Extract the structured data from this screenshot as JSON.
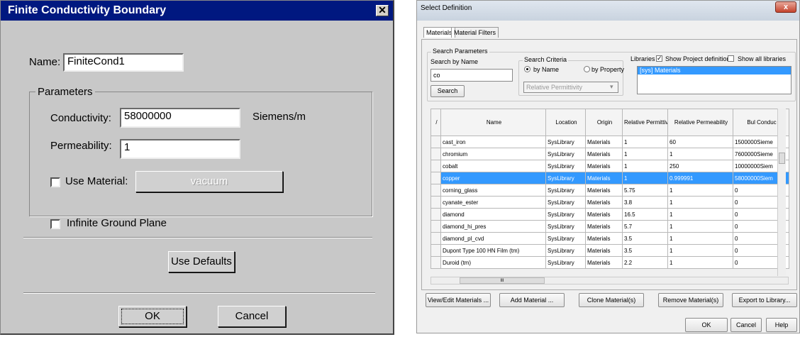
{
  "fcb": {
    "title": "Finite Conductivity Boundary",
    "close_glyph": "✕",
    "name_label": "Name:",
    "name_value": "FiniteCond1",
    "parameters_label": "Parameters",
    "conductivity_label": "Conductivity:",
    "conductivity_value": "58000000",
    "conductivity_unit": "Siemens/m",
    "permeability_label": "Permeability:",
    "permeability_value": "1",
    "use_material_label": "Use Material:",
    "use_material_checked": false,
    "material_button": "vacuum",
    "infinite_ground_label": "Infinite Ground Plane",
    "infinite_ground_checked": false,
    "use_defaults": "Use Defaults",
    "ok": "OK",
    "cancel": "Cancel"
  },
  "sd": {
    "title": "Select Definition",
    "close_glyph": "x",
    "tabs": [
      "Materials",
      "Material Filters"
    ],
    "search_params_label": "Search Parameters",
    "search_by_name_label": "Search by Name",
    "search_value": "co",
    "search_button": "Search",
    "search_criteria_label": "Search Criteria",
    "by_name": "by Name",
    "by_property": "by Property",
    "property_select": "Relative Permittivity",
    "libraries_label": "Libraries",
    "show_project_defs": "Show Project definitions",
    "show_project_checked": true,
    "show_all_libs": "Show all libraries",
    "show_all_checked": false,
    "library_item": "[sys] Materials",
    "columns": [
      "/",
      "Name",
      "Location",
      "Origin",
      "Relative Permittivity",
      "Relative Permeability",
      "Bul Conduc"
    ],
    "rows": [
      [
        "cast_iron",
        "SysLibrary",
        "Materials",
        "1",
        "60",
        "1500000Sieme"
      ],
      [
        "chromium",
        "SysLibrary",
        "Materials",
        "1",
        "1",
        "7600000Sieme"
      ],
      [
        "cobalt",
        "SysLibrary",
        "Materials",
        "1",
        "250",
        "10000000Siem"
      ],
      [
        "copper",
        "SysLibrary",
        "Materials",
        "1",
        "0.999991",
        "58000000Siem"
      ],
      [
        "corning_glass",
        "SysLibrary",
        "Materials",
        "5.75",
        "1",
        "0"
      ],
      [
        "cyanate_ester",
        "SysLibrary",
        "Materials",
        "3.8",
        "1",
        "0"
      ],
      [
        "diamond",
        "SysLibrary",
        "Materials",
        "16.5",
        "1",
        "0"
      ],
      [
        "diamond_hi_pres",
        "SysLibrary",
        "Materials",
        "5.7",
        "1",
        "0"
      ],
      [
        "diamond_pl_cvd",
        "SysLibrary",
        "Materials",
        "3.5",
        "1",
        "0"
      ],
      [
        "Dupont Type 100 HN Film (tm)",
        "SysLibrary",
        "Materials",
        "3.5",
        "1",
        "0"
      ],
      [
        "Duroid (tm)",
        "SysLibrary",
        "Materials",
        "2.2",
        "1",
        "0"
      ]
    ],
    "selected_row": 3,
    "scroll_glyph": "III",
    "buttons": [
      "View/Edit Materials ...",
      "Add Material ...",
      "Clone Material(s)",
      "Remove Material(s)",
      "Export to Library..."
    ],
    "ok": "OK",
    "cancel": "Cancel",
    "help": "Help"
  }
}
